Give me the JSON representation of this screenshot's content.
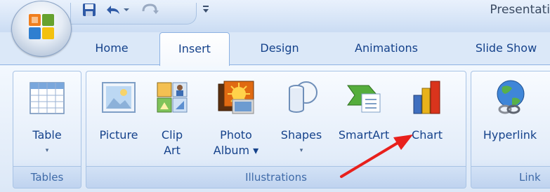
{
  "window": {
    "title": "Presentati"
  },
  "quick_access": [
    {
      "name": "save-icon"
    },
    {
      "name": "undo-icon"
    },
    {
      "name": "redo-icon"
    },
    {
      "name": "customize-qat-icon"
    }
  ],
  "tabs": [
    {
      "label": "Home",
      "active": false
    },
    {
      "label": "Insert",
      "active": true
    },
    {
      "label": "Design",
      "active": false
    },
    {
      "label": "Animations",
      "active": false
    },
    {
      "label": "Slide Show",
      "active": false
    }
  ],
  "groups": {
    "tables": {
      "label": "Tables",
      "buttons": [
        {
          "line1": "Table",
          "line2": "▾",
          "icon": "table-icon"
        }
      ]
    },
    "illustrations": {
      "label": "Illustrations",
      "buttons": [
        {
          "line1": "Picture",
          "line2": "",
          "icon": "picture-icon"
        },
        {
          "line1": "Clip",
          "line2": "Art",
          "icon": "clip-art-icon"
        },
        {
          "line1": "Photo",
          "line2": "Album ▾",
          "icon": "photo-album-icon"
        },
        {
          "line1": "Shapes",
          "line2": "▾",
          "icon": "shapes-icon"
        },
        {
          "line1": "SmartArt",
          "line2": "",
          "icon": "smartart-icon"
        },
        {
          "line1": "Chart",
          "line2": "",
          "icon": "chart-icon"
        }
      ]
    },
    "links": {
      "label": "Link",
      "buttons": [
        {
          "line1": "Hyperlink",
          "line2": "",
          "icon": "hyperlink-icon"
        }
      ]
    }
  },
  "colors": {
    "accent_text": "#15428b",
    "annotation_arrow": "#e8201c"
  }
}
